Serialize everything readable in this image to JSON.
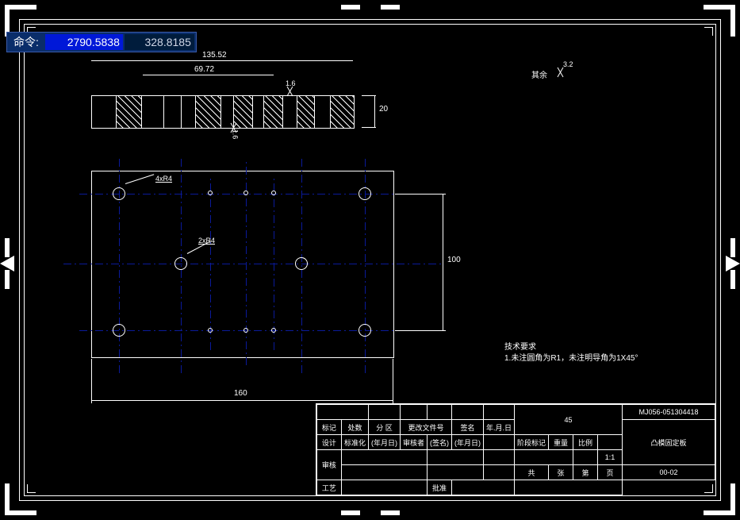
{
  "command": {
    "label": "命令:",
    "x": "2790.5838",
    "y": "328.8185"
  },
  "dims": {
    "top_outer": "135.52",
    "top_inner": "69.72",
    "height": "20",
    "d100": "100",
    "d160": "160",
    "sf1": "1.6",
    "sf2": "1.6",
    "sf3": "3.2"
  },
  "callouts": {
    "r4x4": "4xR4",
    "r4x2": "2xR4"
  },
  "notes": {
    "remainder": "其余",
    "title": "技术要求",
    "line1": "1.未注圆角为R1，未注明导角为1X45°"
  },
  "titleblock": {
    "material": "45",
    "id": "MJ056-051304418",
    "part_name": "凸模固定板",
    "dwg_no": "00-02",
    "scale": "1:1",
    "headers": [
      "标记",
      "处数",
      "分 区",
      "更改文件号",
      "签名",
      "年.月.日"
    ],
    "h2": [
      "阶段标记",
      "重量",
      "比例",
      ""
    ],
    "rows": [
      [
        "设计",
        "标准化",
        "(年月日)",
        "审核者",
        "(签名)",
        "(年月日)",
        ""
      ],
      [
        "审核"
      ],
      [
        "共",
        "张",
        "第",
        "页"
      ],
      [
        "工艺",
        "批准"
      ]
    ]
  }
}
